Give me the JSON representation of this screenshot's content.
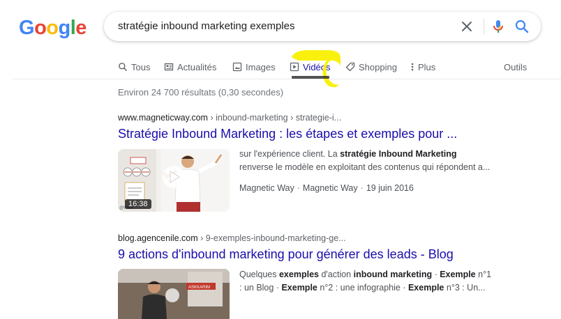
{
  "logo": {
    "letters": [
      "G",
      "o",
      "o",
      "g",
      "l",
      "e"
    ],
    "colors": [
      "#4285f4",
      "#ea4335",
      "#fbbc05",
      "#4285f4",
      "#34a853",
      "#ea4335"
    ]
  },
  "search": {
    "query": "stratégie inbound marketing exemples"
  },
  "tabs": [
    {
      "label": "Tous",
      "icon": "search-icon"
    },
    {
      "label": "Actualités",
      "icon": "news-icon"
    },
    {
      "label": "Images",
      "icon": "image-icon"
    },
    {
      "label": "Vidéos",
      "icon": "video-icon",
      "active": true
    },
    {
      "label": "Shopping",
      "icon": "tag-icon"
    },
    {
      "label": "Plus",
      "icon": "more-vert-icon"
    },
    {
      "label": "Outils"
    }
  ],
  "stats": "Environ 24 700 résultats (0,30 secondes)",
  "results": [
    {
      "domain": "www.magneticway.com",
      "path": " › inbound-marketing › strategie-i...",
      "title": "Stratégie Inbound Marketing : les étapes et exemples pour ...",
      "snippet_line1_a": "sur l'expérience client. La ",
      "snippet_line1_b": "stratégie Inbound Marketing",
      "snippet_line2": "renverse le modèle en exploitant des contenus qui répondent a...",
      "meta_source": "Magnetic Way",
      "meta_author": "Magnetic Way",
      "meta_date": "19 juin 2016",
      "duration": "16:38"
    },
    {
      "domain": "blog.agencenile.com",
      "path": " › 9-exemples-inbound-marketing-ge...",
      "title": "9 actions d'inbound marketing pour générer des leads - Blog",
      "s1": "Quelques ",
      "s2": "exemples",
      "s3": " d'action ",
      "s4": "inbound marketing",
      "s5": " · ",
      "s6": "Exemple",
      "s7": " n°1",
      "s8": ": un Blog · ",
      "s9": "Exemple",
      "s10": " n°2 : une infographie · ",
      "s11": "Exemple",
      "s12": " n°3 : Un..."
    }
  ],
  "colors": {
    "link": "#1a0dab",
    "highlight": "#f9f000"
  }
}
